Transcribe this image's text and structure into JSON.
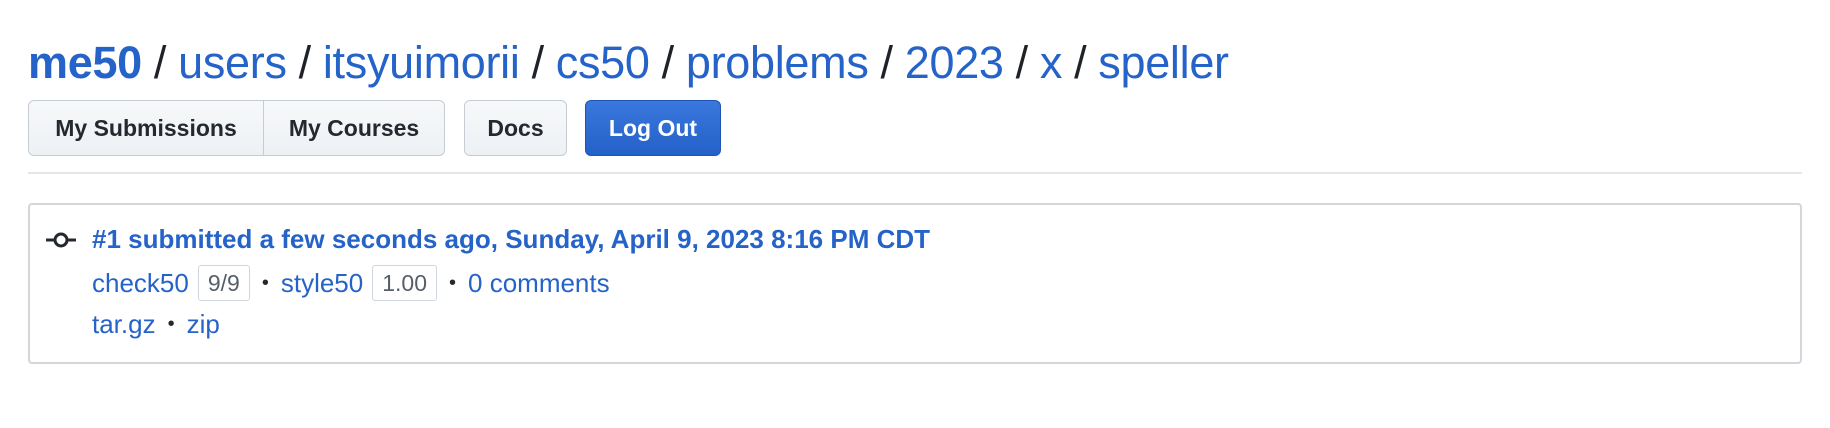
{
  "breadcrumb": {
    "items": [
      "me50",
      "users",
      "itsyuimorii",
      "cs50",
      "problems",
      "2023",
      "x",
      "speller"
    ],
    "separator": "/"
  },
  "nav": {
    "my_submissions": "My Submissions",
    "my_courses": "My Courses",
    "docs": "Docs",
    "log_out": "Log Out"
  },
  "submission": {
    "title": "#1 submitted a few seconds ago, Sunday, April 9, 2023 8:16 PM CDT",
    "check50_label": "check50",
    "check50_score": "9/9",
    "style50_label": "style50",
    "style50_score": "1.00",
    "comments": "0 comments",
    "tar_gz": "tar.gz",
    "zip": "zip",
    "bullet": "•",
    "icon": "commit-icon"
  },
  "colors": {
    "link": "#2563c9",
    "primary_button": "#2461c8"
  }
}
